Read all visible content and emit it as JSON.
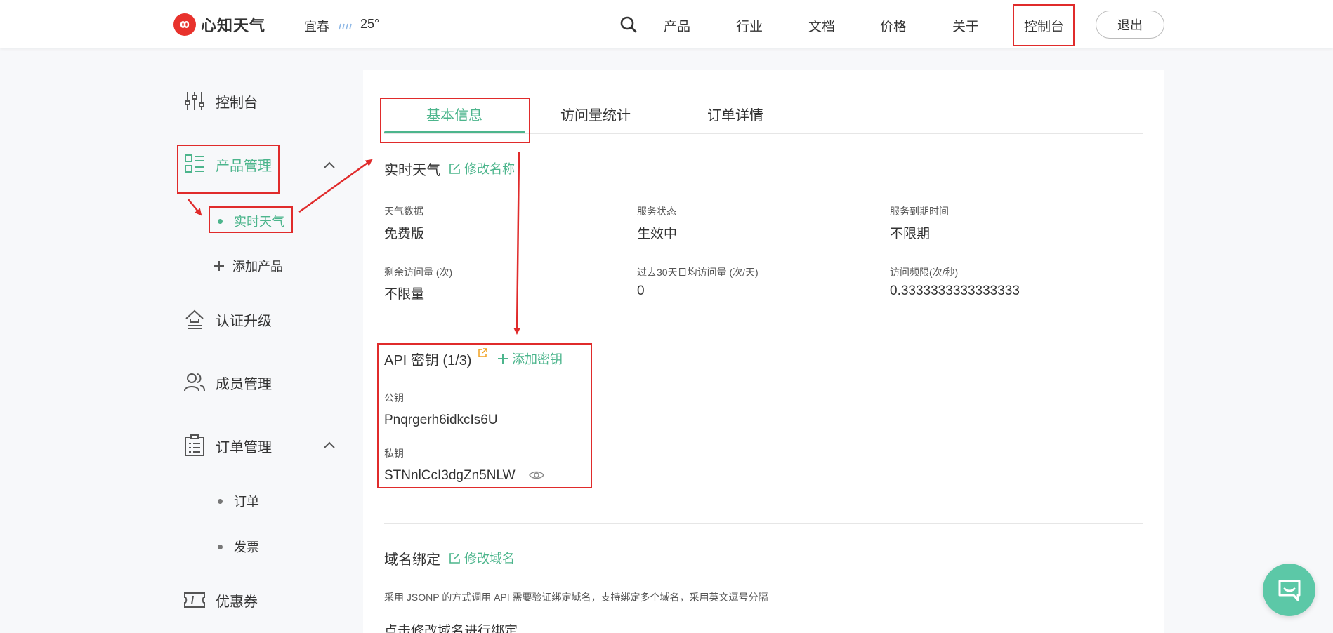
{
  "header": {
    "brand": "心知天气",
    "city": "宜春",
    "temperature": "25°",
    "nav": [
      "产品",
      "行业",
      "文档",
      "价格",
      "关于",
      "控制台"
    ],
    "logout": "退出",
    "icons": [
      "search-icon",
      "rain-icon"
    ],
    "brand_color": "#e8322c"
  },
  "sidebar": {
    "console": "控制台",
    "product_mgmt": "产品管理",
    "realtime_weather": "实时天气",
    "add_product": "添加产品",
    "auth_upgrade": "认证升级",
    "member_mgmt": "成员管理",
    "order_mgmt": "订单管理",
    "orders": "订单",
    "invoice": "发票",
    "coupons": "优惠券",
    "accent_color": "#4cb58c"
  },
  "tabs": [
    "基本信息",
    "访问量统计",
    "订单详情"
  ],
  "product": {
    "name": "实时天气",
    "rename_link": "修改名称",
    "info": [
      {
        "label": "天气数据",
        "value": "免费版"
      },
      {
        "label": "服务状态",
        "value": "生效中"
      },
      {
        "label": "服务到期时间",
        "value": "不限期"
      },
      {
        "label": "剩余访问量 (次)",
        "value": "不限量"
      },
      {
        "label": "过去30天日均访问量 (次/天)",
        "value": "0"
      },
      {
        "label": "访问频限(次/秒)",
        "value": "0.3333333333333333"
      }
    ]
  },
  "api_keys": {
    "title": "API 密钥 (1/3)",
    "add_link": "添加密钥",
    "public_label": "公钥",
    "public_key": "Pnqrgerh6idkcIs6U",
    "private_label": "私钥",
    "private_key": "STNnlCcI3dgZn5NLW"
  },
  "domain": {
    "title": "域名绑定",
    "edit_link": "修改域名",
    "description": "采用 JSONP 的方式调用 API 需要验证绑定域名，支持绑定多个域名，采用英文逗号分隔",
    "cta": "点击修改域名进行绑定"
  },
  "annotation_color": "#e02b2b"
}
